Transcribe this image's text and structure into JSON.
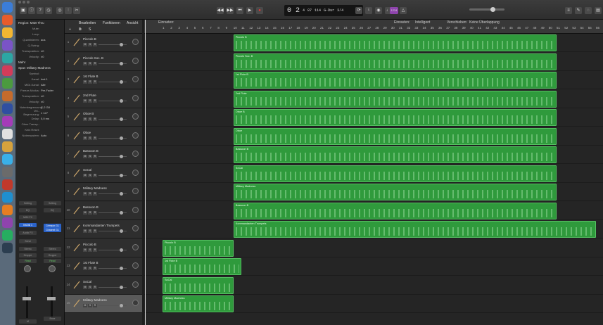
{
  "window": {
    "title": "Logic Pro — Projekt"
  },
  "toolbar": {
    "lcd_bar": "0 2",
    "lcd_beat": "4",
    "lcd_div": "87",
    "tempo": "114",
    "key": "G-Dur",
    "sig": "3/4",
    "badge": "1234",
    "einrasten_label": "Einrasten:",
    "einrasten_value": "Intelligent",
    "verschieben_label": "Verschieben:",
    "verschieben_value": "Keine Überlappung"
  },
  "menu": {
    "bearbeiten": "Bearbeiten",
    "funktionen": "Funktionen",
    "ansicht": "Ansicht"
  },
  "inspector": {
    "region_header": "Region: MIDI Thru",
    "region_rows": [
      {
        "k": "Mute:",
        "v": ""
      },
      {
        "k": "Loop:",
        "v": ""
      },
      {
        "k": "Quantisieren:",
        "v": "aus"
      },
      {
        "k": "Q-Swing:",
        "v": ""
      },
      {
        "k": "Transposition:",
        "v": "±0"
      },
      {
        "k": "Velocity:",
        "v": "±0"
      }
    ],
    "more": "Mehr",
    "spur_header": "Spur: Military Madness",
    "spur_rows": [
      {
        "k": "Symbol:",
        "v": ""
      },
      {
        "k": "Kanal:",
        "v": "Inst 1"
      },
      {
        "k": "MIDI-Kanal:",
        "v": "Alle"
      },
      {
        "k": "Freeze-Modus:",
        "v": "Pre-Fader"
      },
      {
        "k": "Transposition:",
        "v": "±0"
      },
      {
        "k": "Velocity:",
        "v": "±0"
      },
      {
        "k": "Notenbegrenzung:",
        "v": "C-2  G8"
      },
      {
        "k": "Vel.-Begrenzung:",
        "v": "1  127"
      },
      {
        "k": "Delay:",
        "v": "0,0 ms"
      },
      {
        "k": "Ohne Transp.:",
        "v": ""
      },
      {
        "k": "Kein Reset:",
        "v": ""
      },
      {
        "k": "Notensystem:",
        "v": "Auto"
      }
    ]
  },
  "strips": {
    "left": {
      "setting": "Setting",
      "eq": "EQ",
      "midifx": "MIDI FX",
      "input": "Inst/all 1",
      "audiofx": "Audio FX",
      "send": "Send",
      "stereo": "Stereo",
      "group": "Gruppe",
      "auto": "Read",
      "name": "M"
    },
    "right": {
      "setting": "Setting",
      "eq": "EQ",
      "input": "Crimson G1 Channel G1",
      "stereo": "Stereo",
      "group": "Gruppe",
      "auto": "Read",
      "name": "Bnce"
    }
  },
  "tracks": [
    {
      "num": "1",
      "name": "Piccolo B"
    },
    {
      "num": "2",
      "name": "Piccolo Soc. B"
    },
    {
      "num": "3",
      "name": "1st Flute B"
    },
    {
      "num": "4",
      "name": "2nd Flute"
    },
    {
      "num": "5",
      "name": "Oboe B"
    },
    {
      "num": "6",
      "name": "Oboe"
    },
    {
      "num": "7",
      "name": "Bassoon B"
    },
    {
      "num": "8",
      "name": "SoCal"
    },
    {
      "num": "9",
      "name": "Military Madness"
    },
    {
      "num": "10",
      "name": "Bassoon B"
    },
    {
      "num": "11",
      "name": "Kommandanten Trumpets"
    },
    {
      "num": "12",
      "name": "Piccolo B"
    },
    {
      "num": "13",
      "name": "1st Flute B"
    },
    {
      "num": "14",
      "name": "SoCal"
    },
    {
      "num": "15",
      "name": "Military Madness"
    }
  ],
  "ruler": [
    "1",
    "2",
    "3",
    "4",
    "5",
    "6",
    "7",
    "8",
    "9",
    "10",
    "11",
    "12",
    "13",
    "14",
    "15",
    "16",
    "17",
    "18",
    "19",
    "20",
    "21",
    "22",
    "23",
    "24",
    "25",
    "26",
    "27",
    "28",
    "29",
    "30",
    "31",
    "32",
    "33",
    "34",
    "35",
    "36",
    "37",
    "38",
    "39",
    "40",
    "41",
    "42",
    "43",
    "44",
    "45",
    "46",
    "47",
    "48",
    "49",
    "50",
    "51",
    "52",
    "53",
    "54",
    "55",
    "56",
    "57",
    "58"
  ],
  "regions": [
    {
      "name": "Piccolo B",
      "track": 0,
      "start": 10,
      "end": 51
    },
    {
      "name": "Piccolo Soc. B",
      "track": 1,
      "start": 10,
      "end": 51
    },
    {
      "name": "1st Flute B",
      "track": 2,
      "start": 10,
      "end": 51
    },
    {
      "name": "2nd Flute",
      "track": 3,
      "start": 10,
      "end": 51
    },
    {
      "name": "Oboe B",
      "track": 4,
      "start": 10,
      "end": 51
    },
    {
      "name": "Oboe",
      "track": 5,
      "start": 10,
      "end": 51
    },
    {
      "name": "Bassoon B",
      "track": 6,
      "start": 10,
      "end": 51
    },
    {
      "name": "SoCal",
      "track": 7,
      "start": 10,
      "end": 51
    },
    {
      "name": "Military Madness",
      "track": 8,
      "start": 10,
      "end": 51
    },
    {
      "name": "Bassoon B",
      "track": 9,
      "start": 10,
      "end": 51
    },
    {
      "name": "Kommandanten Trumpets",
      "track": 10,
      "start": 10,
      "end": 56
    },
    {
      "name": "Piccolo B",
      "track": 11,
      "start": 1,
      "end": 10
    },
    {
      "name": "1st Flute B",
      "track": 12,
      "start": 1,
      "end": 11
    },
    {
      "name": "SoCal",
      "track": 13,
      "start": 1,
      "end": 10
    },
    {
      "name": "Military Madness",
      "track": 14,
      "start": 1,
      "end": 10
    }
  ],
  "colors": {
    "region": "#2f9a3c",
    "selected_track": "#5a5a5a"
  }
}
